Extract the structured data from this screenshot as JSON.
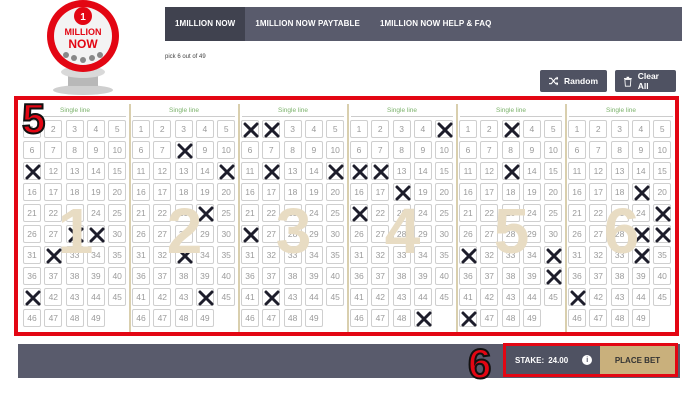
{
  "logo": {
    "text_top": "1",
    "text_mid": "MILLION",
    "text_bottom": "NOW",
    "alt": "1 Million Now logo",
    "icon": "lottery-ball-machine"
  },
  "nav": {
    "tabs": [
      {
        "label": "1MILLION NOW",
        "active": true
      },
      {
        "label": "1MILLION NOW PAYTABLE",
        "active": false
      },
      {
        "label": "1MILLION NOW HELP & FAQ",
        "active": false
      }
    ]
  },
  "pick_instruction": "pick 6 out of 49",
  "toolbar": {
    "random_label": "Random",
    "random_icon": "shuffle-icon",
    "clear_label": "Clear All",
    "clear_icon": "trash-icon"
  },
  "panels": [
    {
      "header": "Single line",
      "number": "1",
      "selected": [
        11,
        28,
        29,
        32,
        41
      ]
    },
    {
      "header": "Single line",
      "number": "2",
      "selected": [
        8,
        15,
        24,
        33,
        44
      ]
    },
    {
      "header": "Single line",
      "number": "3",
      "selected": [
        1,
        2,
        12,
        15,
        26,
        42
      ]
    },
    {
      "header": "Single line",
      "number": "4",
      "selected": [
        5,
        11,
        12,
        18,
        21,
        49
      ]
    },
    {
      "header": "Single line",
      "number": "5",
      "selected": [
        3,
        13,
        31,
        35,
        40,
        46
      ]
    },
    {
      "header": "Single line",
      "number": "6",
      "selected": [
        19,
        25,
        29,
        30,
        34,
        41
      ]
    }
  ],
  "cell_count": 49,
  "annotations": {
    "grid_label": "5",
    "stake_label": "6"
  },
  "stake": {
    "label": "STAKE:",
    "value": "24.00",
    "info_icon": "info-icon"
  },
  "place_bet_label": "PLACE BET",
  "colors": {
    "nav_bg": "#595b6c",
    "nav_active": "#40424f",
    "header_green": "#7bb26b",
    "place_bet": "#c9b07c",
    "highlight_red": "#e30613"
  }
}
